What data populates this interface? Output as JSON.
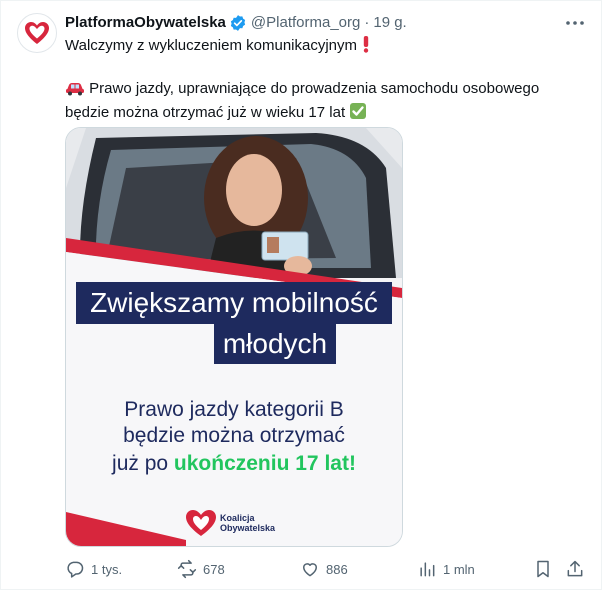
{
  "author": {
    "name": "PlatformaObywatelska",
    "handle": "@Platforma_org",
    "separator": "·",
    "time": "19 g."
  },
  "tweet": {
    "line1": "Walczymy z wykluczeniem komunikacyjnym",
    "line2": "Prawo jazdy, uprawniające do prowadzenia samochodu osobowego",
    "line3": "będzie można otrzymać już w wieku 17 lat"
  },
  "card": {
    "headline_line1": "Zwiększamy mobilność",
    "headline_line2": "młodych",
    "body_line1": "Prawo jazdy kategorii B",
    "body_line2": "będzie można otrzymać",
    "body_line3_prefix": "już po ",
    "body_line3_highlight": "ukończeniu 17 lat!",
    "logo_line1": "Koalicja",
    "logo_line2": "Obywatelska",
    "colors": {
      "navy": "#1e2a5e",
      "green": "#22c55e",
      "red": "#d7263d"
    }
  },
  "actions": {
    "replies": "1 tys.",
    "reposts": "678",
    "likes": "886",
    "views": "1 mln"
  },
  "icons": {
    "verified": "verified-badge-icon",
    "more": "more-icon",
    "car": "car-emoji-icon",
    "exclamation": "exclamation-emoji-icon",
    "check": "check-emoji-icon",
    "reply": "reply-icon",
    "repost": "repost-icon",
    "like": "heart-icon",
    "views": "views-icon",
    "bookmark": "bookmark-icon",
    "share": "share-icon"
  }
}
